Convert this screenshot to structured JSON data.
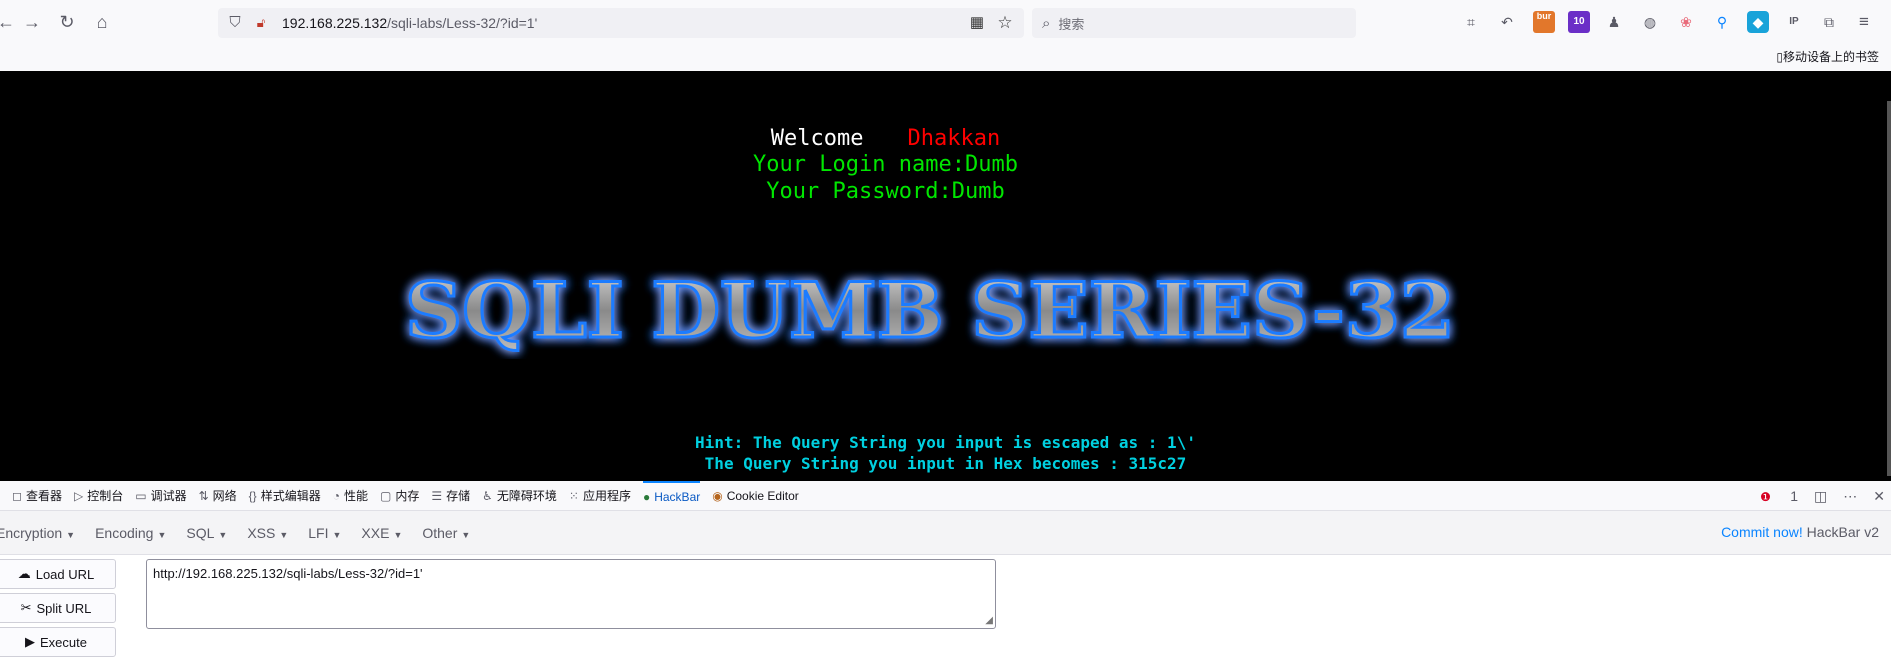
{
  "browser": {
    "url_host": "192.168.225.132",
    "url_path": "/sqli-labs/Less-32/?id=1'",
    "search_placeholder": "搜索",
    "bookmark_label": "移动设备上的书签",
    "ext_burp_label": "bur",
    "ext_badge_count": "10"
  },
  "page": {
    "welcome": "Welcome",
    "welcome_name": "Dhakkan",
    "login_line": "Your Login name:Dumb",
    "password_line": "Your Password:Dumb",
    "banner": "SQLI DUMB SERIES-32",
    "hint1": "Hint: The Query String you input is escaped as : 1\\'",
    "hint2": "The Query String you input in Hex becomes : 315c27"
  },
  "devtools": {
    "tabs": [
      "查看器",
      "控制台",
      "调试器",
      "网络",
      "样式编辑器",
      "性能",
      "内存",
      "存储",
      "无障碍环境",
      "应用程序",
      "HackBar",
      "Cookie Editor"
    ],
    "error_count": "1"
  },
  "hackbar": {
    "menu": [
      "Encryption",
      "Encoding",
      "SQL",
      "XSS",
      "LFI",
      "XXE",
      "Other"
    ],
    "commit_label": "Commit now!",
    "version_label": "HackBar v2",
    "load_url": "Load URL",
    "split_url": "Split URL",
    "execute": "Execute",
    "url_value": "http://192.168.225.132/sqli-labs/Less-32/?id=1'"
  },
  "colors": {
    "accent": "#0a84ff",
    "content_bg": "#000000",
    "welcome_name": "#ff0000",
    "login_text": "#00e600",
    "hint_text": "#00d0e0"
  }
}
